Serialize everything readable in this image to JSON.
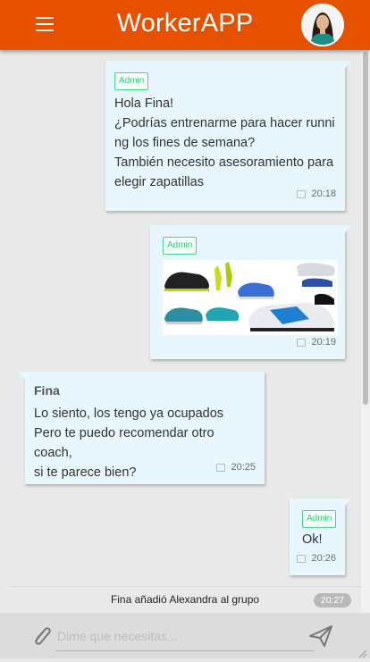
{
  "header": {
    "title": "WorkerAPP",
    "menu_icon": "hamburger-menu-icon",
    "avatar": "user-avatar"
  },
  "messages": [
    {
      "badge": "Admin",
      "lines": [
        "Hola Fina!",
        "¿Podrías entrenarme para hacer runni",
        "ng los fines de semana?",
        "También necesito asesoramiento para",
        "elegir zapatillas"
      ],
      "time": "20:18"
    },
    {
      "badge": "Admin",
      "image": "running-shoes-image",
      "time": "20:19"
    },
    {
      "sender": "Fina",
      "lines": [
        "Lo siento, los tengo ya ocupados",
        "Pero te puedo recomendar otro coach,",
        "si te parece bien?"
      ],
      "time": "20:25"
    },
    {
      "badge": "Admin",
      "lines": [
        "Ok!"
      ],
      "time": "20:26"
    }
  ],
  "system": {
    "text": "Fina añadió Alexandra al grupo",
    "time": "20:27"
  },
  "composer": {
    "placeholder": "Dime que necesitas...",
    "attach_icon": "paperclip-icon",
    "send_icon": "send-icon"
  },
  "colors": {
    "header": "#e65100",
    "bubble": "#e8f6fd",
    "badge": "#3cc777",
    "background": "#e9e9e9"
  }
}
